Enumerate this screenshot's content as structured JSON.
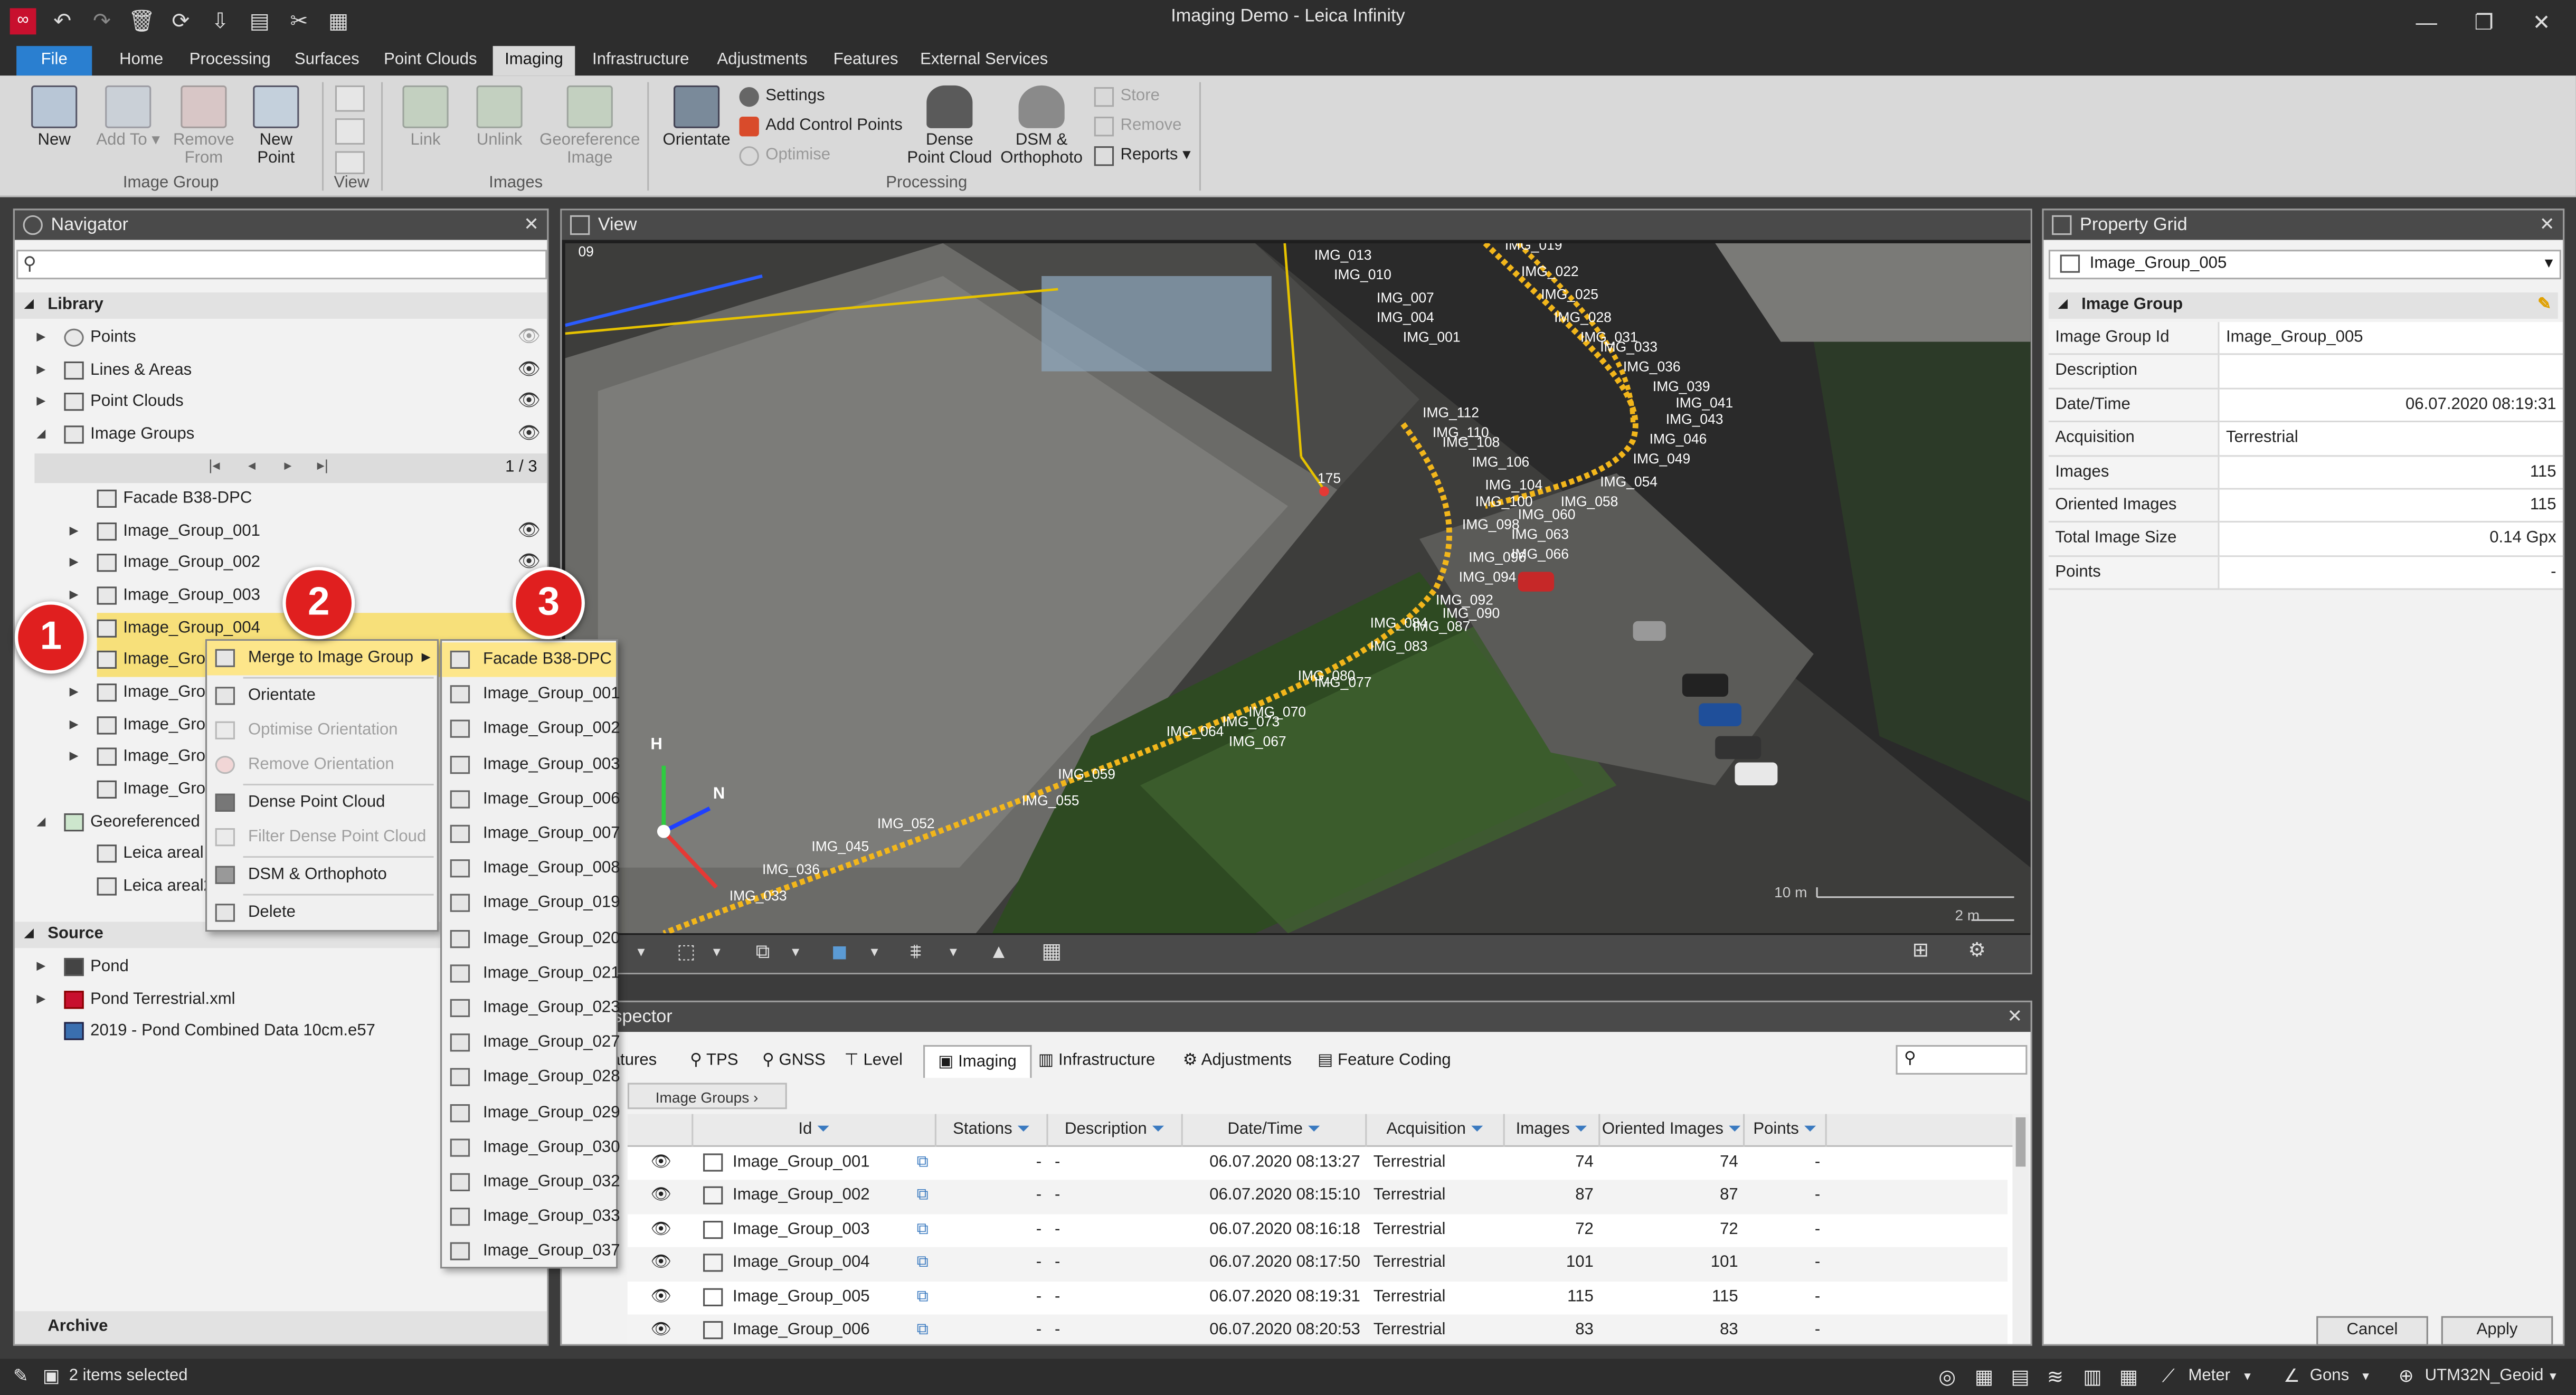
{
  "window": {
    "title": "Imaging Demo - Leica Infinity",
    "minimize": "—",
    "maximize": "❐",
    "close": "✕"
  },
  "menu_tabs": [
    "File",
    "Home",
    "Processing",
    "Surfaces",
    "Point Clouds",
    "Imaging",
    "Infrastructure",
    "Adjustments",
    "Features",
    "External Services"
  ],
  "active_tab": "Imaging",
  "ribbon": {
    "new": "New",
    "add_to": "Add To",
    "add_to_arrow": "▾",
    "remove_from": "Remove From",
    "new_point": "New Point",
    "image_group": "Image Group",
    "view": "View",
    "link": "Link",
    "unlink": "Unlink",
    "georeference": "Georeference Image",
    "images": "Images",
    "orientate": "Orientate",
    "settings": "Settings",
    "add_control_points": "Add Control Points",
    "optimise": "Optimise",
    "dense_point_cloud": "Dense Point Cloud",
    "dsm_orthophoto": "DSM & Orthophoto",
    "store": "Store",
    "remove": "Remove",
    "reports": "Reports",
    "processing": "Processing"
  },
  "navigator": {
    "title": "Navigator",
    "close": "✕",
    "search_icon": "⚲",
    "library": "Library",
    "items": {
      "points": "Points",
      "lines_areas": "Lines & Areas",
      "point_clouds": "Point Clouds",
      "image_groups": "Image Groups",
      "pager": "1 / 3",
      "pager_first": "|◂",
      "pager_prev": "◂",
      "pager_next": "▸",
      "pager_last": "▸|",
      "facade": "Facade B38-DPC",
      "ig001": "Image_Group_001",
      "ig002": "Image_Group_002",
      "ig003": "Image_Group_003",
      "ig004": "Image_Group_004",
      "ig005": "Image_Grou",
      "ig006": "Image_Grou",
      "ig007": "Image_Grou",
      "ig008": "Image_Grou",
      "ig009": "Image_Grou",
      "georeferenced": "Georeferenced",
      "leica1": "Leica areal",
      "leica2": "Leica areal2"
    },
    "source": "Source",
    "source_items": {
      "pond": "Pond",
      "pond_xml": "Pond Terrestrial.xml",
      "pond_e57": "2019 - Pond Combined Data 10cm.e57"
    },
    "archive": "Archive"
  },
  "context_menu": {
    "merge": "Merge to Image Group",
    "orientate": "Orientate",
    "optimise_orientation": "Optimise Orientation",
    "remove_orientation": "Remove Orientation",
    "dense_point_cloud": "Dense Point Cloud",
    "filter_dense": "Filter Dense Point Cloud",
    "dsm": "DSM & Orthophoto",
    "delete": "Delete"
  },
  "submenu": [
    "Facade B38-DPC",
    "Image_Group_001",
    "Image_Group_002",
    "Image_Group_003",
    "Image_Group_006",
    "Image_Group_007",
    "Image_Group_008",
    "Image_Group_019",
    "Image_Group_020",
    "Image_Group_021",
    "Image_Group_023",
    "Image_Group_027",
    "Image_Group_028",
    "Image_Group_029",
    "Image_Group_030",
    "Image_Group_032",
    "Image_Group_033",
    "Image_Group_037"
  ],
  "badges": [
    "1",
    "2",
    "3"
  ],
  "view": {
    "title": "View",
    "axis_h": "H",
    "axis_n": "N",
    "scale_10m": "10 m",
    "scale_2m": "2 m",
    "labels": [
      "IMG_013",
      "IMG_010",
      "IMG_007",
      "IMG_004",
      "IMG_001",
      "IMG_019",
      "IMG_022",
      "IMG_025",
      "IMG_028",
      "IMG_031",
      "IMG_033",
      "IMG_036",
      "IMG_039",
      "IMG_041",
      "IMG_043",
      "IMG_046",
      "IMG_049",
      "IMG_054",
      "IMG_058",
      "IMG_060",
      "IMG_063",
      "IMG_066",
      "IMG_112",
      "IMG_110",
      "IMG_108",
      "IMG_106",
      "IMG_104",
      "IMG_100",
      "IMG_098",
      "IMG_096",
      "IMG_094",
      "IMG_092",
      "IMG_090",
      "IMG_087",
      "IMG_084",
      "IMG_083",
      "IMG_080",
      "IMG_077",
      "IMG_073",
      "IMG_070",
      "IMG_067",
      "IMG_064",
      "IMG_059",
      "IMG_055",
      "IMG_052",
      "IMG_045",
      "IMG_036",
      "IMG_033",
      "175",
      "09"
    ]
  },
  "inspector": {
    "title": "Inspector",
    "close": "✕",
    "tabs": [
      "atures",
      "TPS",
      "GNSS",
      "Level",
      "Imaging",
      "Infrastructure",
      "Adjustments",
      "Feature Coding"
    ],
    "active_tab": "Imaging",
    "breadcrumb": "Image Groups",
    "columns": [
      "Id",
      "Stations",
      "Description",
      "Date/Time",
      "Acquisition",
      "Images",
      "Oriented Images",
      "Points"
    ],
    "rows": [
      {
        "id": "Image_Group_001",
        "stations": "-",
        "description": "-",
        "datetime": "06.07.2020 08:13:27",
        "acquisition": "Terrestrial",
        "images": "74",
        "oriented": "74",
        "points": "-"
      },
      {
        "id": "Image_Group_002",
        "stations": "-",
        "description": "-",
        "datetime": "06.07.2020 08:15:10",
        "acquisition": "Terrestrial",
        "images": "87",
        "oriented": "87",
        "points": "-"
      },
      {
        "id": "Image_Group_003",
        "stations": "-",
        "description": "-",
        "datetime": "06.07.2020 08:16:18",
        "acquisition": "Terrestrial",
        "images": "72",
        "oriented": "72",
        "points": "-"
      },
      {
        "id": "Image_Group_004",
        "stations": "-",
        "description": "-",
        "datetime": "06.07.2020 08:17:50",
        "acquisition": "Terrestrial",
        "images": "101",
        "oriented": "101",
        "points": "-"
      },
      {
        "id": "Image_Group_005",
        "stations": "-",
        "description": "-",
        "datetime": "06.07.2020 08:19:31",
        "acquisition": "Terrestrial",
        "images": "115",
        "oriented": "115",
        "points": "-"
      },
      {
        "id": "Image_Group_006",
        "stations": "-",
        "description": "-",
        "datetime": "06.07.2020 08:20:53",
        "acquisition": "Terrestrial",
        "images": "83",
        "oriented": "83",
        "points": "-"
      }
    ]
  },
  "property_grid": {
    "title": "Property Grid",
    "close": "✕",
    "selected": "Image_Group_005",
    "dropdown_arrow": "▾",
    "section": "Image Group",
    "props": [
      {
        "key": "Image Group Id",
        "value": "Image_Group_005",
        "align": "left"
      },
      {
        "key": "Description",
        "value": "",
        "align": "left"
      },
      {
        "key": "Date/Time",
        "value": "06.07.2020 08:19:31",
        "align": "right"
      },
      {
        "key": "Acquisition",
        "value": "Terrestrial",
        "align": "left"
      },
      {
        "key": "Images",
        "value": "115",
        "align": "right"
      },
      {
        "key": "Oriented Images",
        "value": "115",
        "align": "right"
      },
      {
        "key": "Total Image Size",
        "value": "0.14 Gpx",
        "align": "right"
      },
      {
        "key": "Points",
        "value": "-",
        "align": "right"
      }
    ],
    "cancel": "Cancel",
    "apply": "Apply"
  },
  "status": {
    "selected": "2 items selected",
    "units": "Meter",
    "angle": "Gons",
    "crs": "UTM32N_Geoid"
  },
  "colors": {
    "accent": "#2a7fd0",
    "highlight": "#fde68a",
    "badge": "#e01f1f",
    "track": "#f2b61b"
  }
}
